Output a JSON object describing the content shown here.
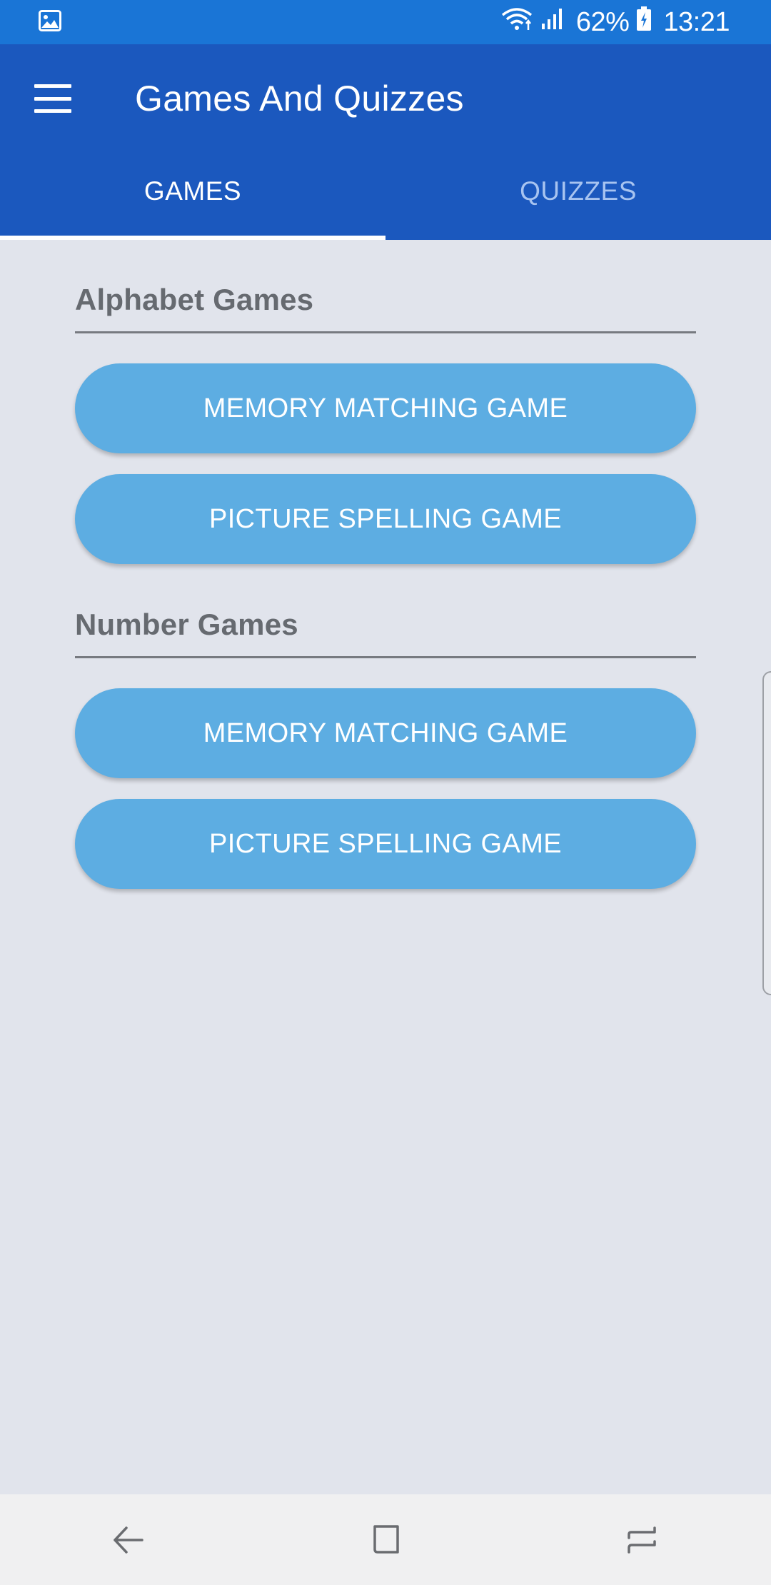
{
  "status_bar": {
    "battery_percent": "62%",
    "time": "13:21"
  },
  "app_bar": {
    "title": "Games And Quizzes"
  },
  "tabs": [
    {
      "label": "GAMES",
      "active": true
    },
    {
      "label": "QUIZZES",
      "active": false
    }
  ],
  "sections": [
    {
      "title": "Alphabet Games",
      "buttons": [
        "MEMORY MATCHING GAME",
        "PICTURE SPELLING GAME"
      ]
    },
    {
      "title": "Number Games",
      "buttons": [
        "MEMORY MATCHING GAME",
        "PICTURE SPELLING GAME"
      ]
    }
  ],
  "colors": {
    "status_bar": "#1a75d6",
    "app_bar": "#1b58be",
    "button": "#5dade2",
    "background": "#e1e4ec",
    "section_title": "#666a70"
  },
  "icons": {
    "status_left": "image-notification-icon",
    "wifi": "wifi-icon",
    "signal": "signal-icon",
    "battery": "battery-charging-icon",
    "menu": "hamburger-menu-icon",
    "nav_back": "back-icon",
    "nav_home": "home-icon",
    "nav_recents": "recents-icon"
  }
}
